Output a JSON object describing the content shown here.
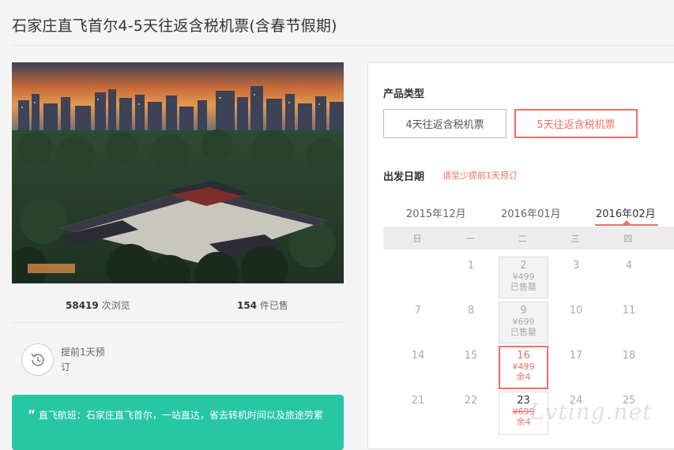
{
  "page": {
    "title": "石家庄直飞首尔4-5天往返含税机票(含春节假期)"
  },
  "stats": {
    "views_count": "58419",
    "views_label": " 次浏览",
    "sold_count": "154",
    "sold_label": " 件已售"
  },
  "booking": {
    "note": "提前1天预订"
  },
  "flight": {
    "quote_mark": "“",
    "text": "直飞航班：石家庄直飞首尔，一站直达，省去转机时间以及旅途劳累"
  },
  "product": {
    "label": "产品类型",
    "options": [
      "4天往返含税机票",
      "5天往返含税机票"
    ],
    "selected_index": 1
  },
  "date": {
    "label": "出发日期",
    "hint": "请至少提前1天预订",
    "months": [
      "2015年12月",
      "2016年01月",
      "2016年02月"
    ],
    "active_month_index": 2,
    "weekdays": [
      "日",
      "一",
      "二",
      "三",
      "四"
    ],
    "days": {
      "d1": "1",
      "d2": "2",
      "d3": "3",
      "d4": "4",
      "d7": "7",
      "d8": "8",
      "d9": "9",
      "d10": "10",
      "d11": "11",
      "d14": "14",
      "d15": "15",
      "d16": "16",
      "d17": "17",
      "d18": "18",
      "d21": "21",
      "d22": "22",
      "d23": "23",
      "d24": "24",
      "d25": "25"
    },
    "d2_price": "¥499",
    "d2_status": "已售罄",
    "d9_price": "¥699",
    "d9_status": "已售罄",
    "d16_price": "¥499",
    "d16_status": "余4",
    "d23_price": "¥699",
    "d23_status": "余4"
  },
  "watermark": "Lvting.net",
  "colors": {
    "accent": "#f06e66",
    "teal": "#27c7a5"
  }
}
